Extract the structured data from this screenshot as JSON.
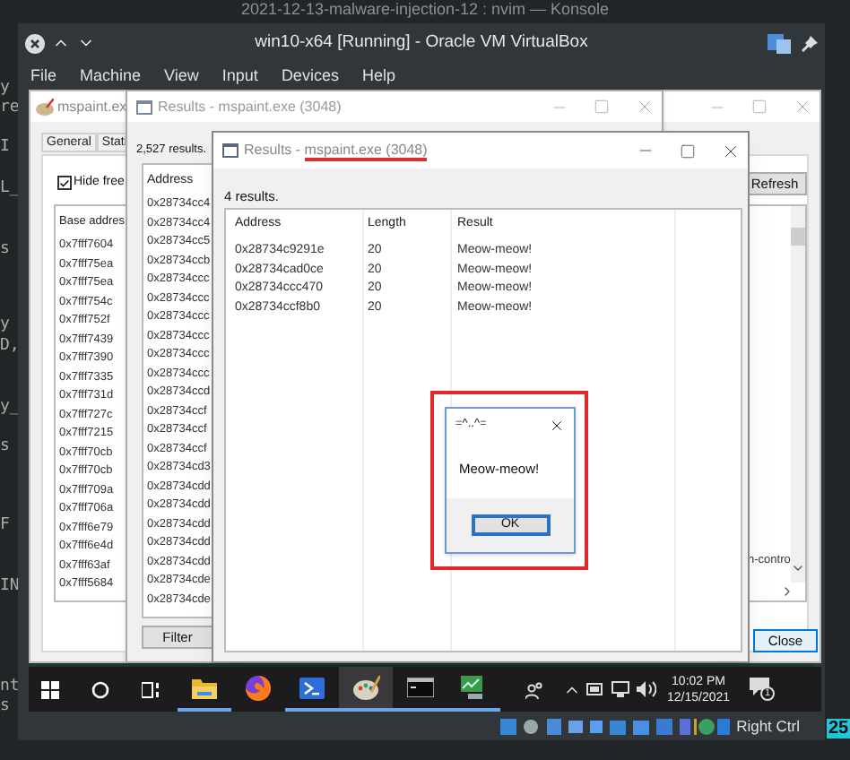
{
  "konsole": {
    "title": "2021-12-13-malware-injection-12 : nvim — Konsole",
    "fragments": [
      "y",
      "re",
      "I",
      "L_",
      "s",
      "y",
      "D,",
      "y_",
      "s",
      "F",
      "IN",
      "nt",
      "s"
    ]
  },
  "vbox": {
    "title": "win10-x64 [Running] - Oracle VM VirtualBox",
    "menu": [
      "File",
      "Machine",
      "View",
      "Input",
      "Devices",
      "Help"
    ],
    "host_key": "Right Ctrl"
  },
  "workspace_badge": "25",
  "memory_window": {
    "title": "mspaint.ex",
    "tabs": [
      {
        "label": "General",
        "selected": false
      },
      {
        "label": "Stati",
        "selected": false
      }
    ],
    "hide_free": {
      "label": "Hide free",
      "checked": true
    },
    "column": "Base addres",
    "rows": [
      "0x7fff7604",
      "0x7fff75ea",
      "0x7fff75ea",
      "0x7fff754c",
      "0x7fff752f",
      "0x7fff7439",
      "0x7fff7390",
      "0x7fff7335",
      "0x7fff731d",
      "0x7fff727c",
      "0x7fff7215",
      "0x7fff70cb",
      "0x7fff70cb",
      "0x7fff709a",
      "0x7fff706a",
      "0x7fff6e79",
      "0x7fff6e4d",
      "0x7fff63af",
      "0x7fff5684"
    ],
    "refresh": "Refresh",
    "protection_text": "n-contro",
    "close": "Close"
  },
  "results_all": {
    "title": "Results - mspaint.exe (3048)",
    "count": "2,527 results.",
    "column": "Address",
    "rows": [
      "0x28734cc4",
      "0x28734cc4",
      "0x28734cc5",
      "0x28734ccb",
      "0x28734ccc",
      "0x28734ccc",
      "0x28734ccc",
      "0x28734ccc",
      "0x28734ccc",
      "0x28734ccc",
      "0x28734ccd",
      "0x28734ccf",
      "0x28734ccf",
      "0x28734ccf",
      "0x28734cd3",
      "0x28734cdd",
      "0x28734cdd",
      "0x28734cdd",
      "0x28734cdd",
      "0x28734cdd",
      "0x28734cde",
      "0x28734cde"
    ],
    "filter": "Filter"
  },
  "results_match": {
    "title_prefix": "Results - ",
    "title_highlight": "mspaint.exe (3048)",
    "count": "4 results.",
    "columns": [
      "Address",
      "Length",
      "Result"
    ],
    "rows": [
      [
        "0x28734c9291e",
        "20",
        "Meow-meow!"
      ],
      [
        "0x28734cad0ce",
        "20",
        "Meow-meow!"
      ],
      [
        "0x28734ccc470",
        "20",
        "Meow-meow!"
      ],
      [
        "0x28734ccf8b0",
        "20",
        "Meow-meow!"
      ]
    ]
  },
  "message_box": {
    "title": "=^..^=",
    "message": "Meow-meow!",
    "button": "OK"
  },
  "taskbar": {
    "apps": [
      {
        "kind": "folder",
        "running": true,
        "active": false
      },
      {
        "kind": "browser",
        "running": false,
        "active": false
      },
      {
        "kind": "shell",
        "running": true,
        "active": false
      },
      {
        "kind": "paint",
        "running": true,
        "active": true
      },
      {
        "kind": "console",
        "running": true,
        "active": false
      },
      {
        "kind": "monitor",
        "running": true,
        "active": false
      }
    ],
    "time": "10:02 PM",
    "date": "12/15/2021",
    "notifications": "1"
  }
}
